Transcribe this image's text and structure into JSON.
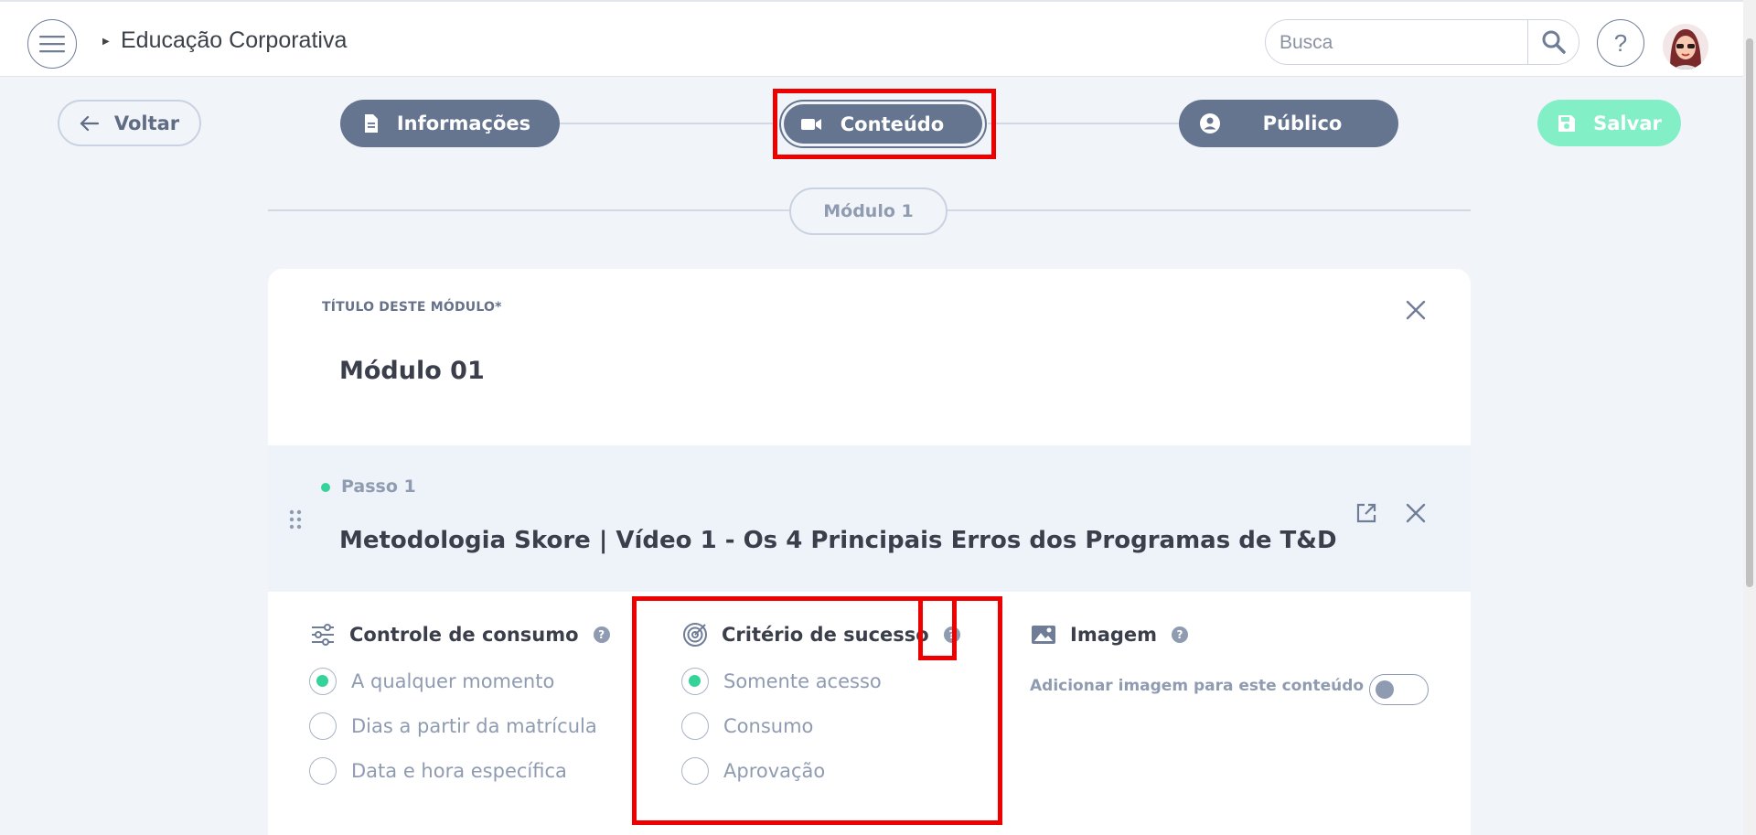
{
  "header": {
    "app_title": "Educação Corporativa",
    "search_placeholder": "Busca",
    "help_label": "?"
  },
  "nav": {
    "back_label": "Voltar",
    "steps": [
      {
        "label": "Informações",
        "icon": "document-icon"
      },
      {
        "label": "Conteúdo",
        "icon": "video-camera-icon",
        "active": true
      },
      {
        "label": "Público",
        "icon": "user-circle-icon"
      }
    ],
    "save_label": "Salvar",
    "module_tab": "Módulo 1"
  },
  "module": {
    "field_label": "TÍTULO DESTE MÓDULO*",
    "title": "Módulo 01"
  },
  "step": {
    "label": "Passo 1",
    "title": "Metodologia Skore | Vídeo 1 - Os 4 Principais Erros dos Programas de T&D"
  },
  "consumption": {
    "heading": "Controle de consumo",
    "options": [
      "A qualquer momento",
      "Dias a partir da matrícula",
      "Data e hora específica"
    ],
    "selected": 0
  },
  "success": {
    "heading": "Critério de sucesso",
    "options": [
      "Somente acesso",
      "Consumo",
      "Aprovação"
    ],
    "selected": 0
  },
  "image": {
    "heading": "Imagem",
    "toggle_label": "Adicionar imagem para este conteúdo",
    "enabled": false
  },
  "colors": {
    "primary": "#65748f",
    "accent_green": "#34d399",
    "save_green": "#83efc6",
    "annotation_red": "#ee0000"
  }
}
